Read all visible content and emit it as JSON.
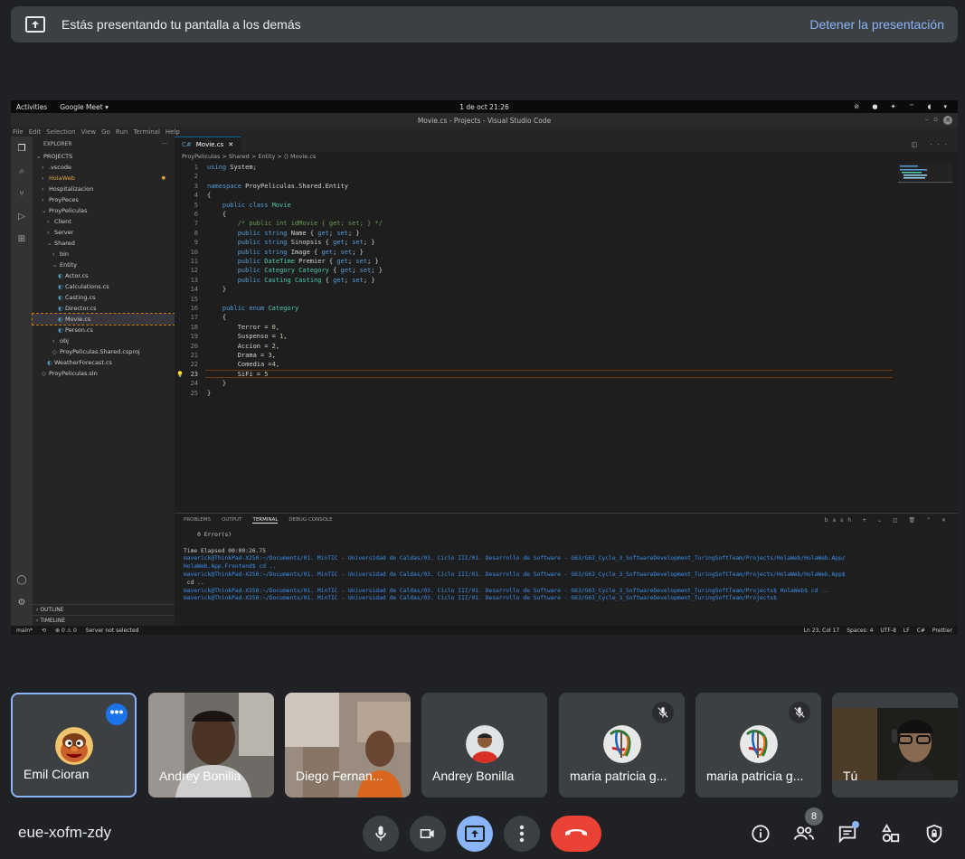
{
  "banner": {
    "message": "Estás presentando tu pantalla a los demás",
    "stop_label": "Detener la presentación"
  },
  "screen": {
    "gnome": {
      "activities": "Activities",
      "app": "Google Meet ▾",
      "clock": "1 de oct  21:26"
    },
    "window_title": "Movie.cs - Projects - Visual Studio Code",
    "menu": [
      "File",
      "Edit",
      "Selection",
      "View",
      "Go",
      "Run",
      "Terminal",
      "Help"
    ],
    "explorer": {
      "header": "EXPLORER",
      "items": [
        {
          "label": "PROJECTS",
          "indent": 0,
          "caret": "⌄"
        },
        {
          "label": ".vscode",
          "indent": 1,
          "caret": "›"
        },
        {
          "label": "HolaWeb",
          "indent": 1,
          "caret": "›",
          "kind": "web",
          "badge": "●"
        },
        {
          "label": "Hospitalizacion",
          "indent": 1,
          "caret": "›"
        },
        {
          "label": "ProyPeces",
          "indent": 1,
          "caret": "›"
        },
        {
          "label": "ProyPeliculas",
          "indent": 1,
          "caret": "⌄"
        },
        {
          "label": "Client",
          "indent": 2,
          "caret": "›"
        },
        {
          "label": "Server",
          "indent": 2,
          "caret": "›"
        },
        {
          "label": "Shared",
          "indent": 2,
          "caret": "⌄"
        },
        {
          "label": "bin",
          "indent": 3,
          "caret": "›"
        },
        {
          "label": "Entity",
          "indent": 3,
          "caret": "⌄"
        },
        {
          "label": "Actor.cs",
          "indent": 4,
          "kind": "cs"
        },
        {
          "label": "Calculations.cs",
          "indent": 4,
          "kind": "cs"
        },
        {
          "label": "Casting.cs",
          "indent": 4,
          "kind": "cs"
        },
        {
          "label": "Director.cs",
          "indent": 4,
          "kind": "cs"
        },
        {
          "label": "Movie.cs",
          "indent": 4,
          "kind": "cs",
          "selected": true
        },
        {
          "label": "Person.cs",
          "indent": 4,
          "kind": "cs"
        },
        {
          "label": "obj",
          "indent": 3,
          "caret": "›"
        },
        {
          "label": "ProyPeliculas.Shared.csproj",
          "indent": 3,
          "kind": "proj"
        },
        {
          "label": "WeatherForecast.cs",
          "indent": 2,
          "kind": "cs"
        },
        {
          "label": "ProyPeliculas.sln",
          "indent": 1,
          "kind": "sln"
        }
      ],
      "outline": "OUTLINE",
      "timeline": "TIMELINE"
    },
    "tab": "Movie.cs",
    "breadcrumb": "ProyPeliculas > Shared > Entity > ⟨⟩ Movie.cs",
    "code": [
      "using System;",
      "",
      "namespace ProyPeliculas.Shared.Entity",
      "{",
      "    public class Movie",
      "    {",
      "        /* public int idMovie { get; set; } */",
      "        public string Name { get; set; }",
      "        public string Sinopsis { get; set; }",
      "        public string Image { get; set; }",
      "        public DateTime Premier { get; set; }",
      "        public Category Category { get; set; }",
      "        public Casting Casting { get; set; }",
      "    }",
      "",
      "    public enum Category",
      "    {",
      "        Terror = 0,",
      "        Suspenso = 1,",
      "        Accion = 2,",
      "        Drama = 3,",
      "        Comedia =4,",
      "        SiFi = 5",
      "    }",
      "}"
    ],
    "current_line": 23,
    "panel_tabs": [
      "PROBLEMS",
      "OUTPUT",
      "TERMINAL",
      "DEBUG CONSOLE"
    ],
    "panel_actions": "bash  + ⌄ ◫ 🗑 ⌃ ✕",
    "terminal": [
      {
        "t": "    0 Error(s)",
        "p": false
      },
      {
        "t": "",
        "p": false
      },
      {
        "t": "Time Elapsed 00:00:26.75",
        "p": false
      },
      {
        "t": "maverick@ThinkPad-X250:~/Documents/01. MinTIC - Universidad de Caldas/03. Ciclo III/01. Desarrollo de Software - G63/G63_Cycle_3_SoftwareDevelopment_TuringSoftTeam/Projects/HolaWeb/HolaWeb.App/",
        "p": true
      },
      {
        "t": "HolaWeb.App.Frontend$ cd ..",
        "p": true
      },
      {
        "t": "maverick@ThinkPad-X250:~/Documents/01. MinTIC - Universidad de Caldas/03. Ciclo III/01. Desarrollo de Software - G63/G63_Cycle_3_SoftwareDevelopment_TuringSoftTeam/Projects/HolaWeb/HolaWeb.App$",
        "p": true
      },
      {
        "t": " cd ..",
        "p": false
      },
      {
        "t": "maverick@ThinkPad-X250:~/Documents/01. MinTIC - Universidad de Caldas/03. Ciclo III/01. Desarrollo de Software - G63/G63_Cycle_3_SoftwareDevelopment_TuringSoftTeam/Projects$ HolaWeb$ cd ..",
        "p": true
      },
      {
        "t": "maverick@ThinkPad-X250:~/Documents/01. MinTIC - Universidad de Caldas/03. Ciclo III/01. Desarrollo de Software - G63/G63_Cycle_3_SoftwareDevelopment_TuringSoftTeam/Projects$",
        "p": true
      }
    ],
    "status_left": [
      "main*",
      "⊗ 0 ⚠ 0",
      "Server not selected"
    ],
    "status_right": [
      "Ln 23, Col 17",
      "Spaces: 4",
      "UTF-8",
      "LF",
      "C#",
      "Prettier"
    ]
  },
  "participants": [
    {
      "name": "Emil Cioran",
      "type": "avatar",
      "muted": false,
      "me": true,
      "more": "•••"
    },
    {
      "name": "Andrey Bonilla",
      "type": "video1",
      "muted": false
    },
    {
      "name": "Diego Fernan...",
      "type": "video2",
      "muted": false
    },
    {
      "name": "Andrey Bonilla",
      "type": "avatar2",
      "muted": false
    },
    {
      "name": "maria patricia g...",
      "type": "avatar3",
      "muted": true
    },
    {
      "name": "maria patricia g...",
      "type": "avatar3",
      "muted": true
    },
    {
      "name": "Tú",
      "type": "video3",
      "muted": false
    }
  ],
  "meeting_code": "eue-xofm-zdy",
  "people_count": "8",
  "colors": {
    "hangup": "#ea4335",
    "present_active": "#8ab4f8",
    "accent": "#1a73e8"
  }
}
